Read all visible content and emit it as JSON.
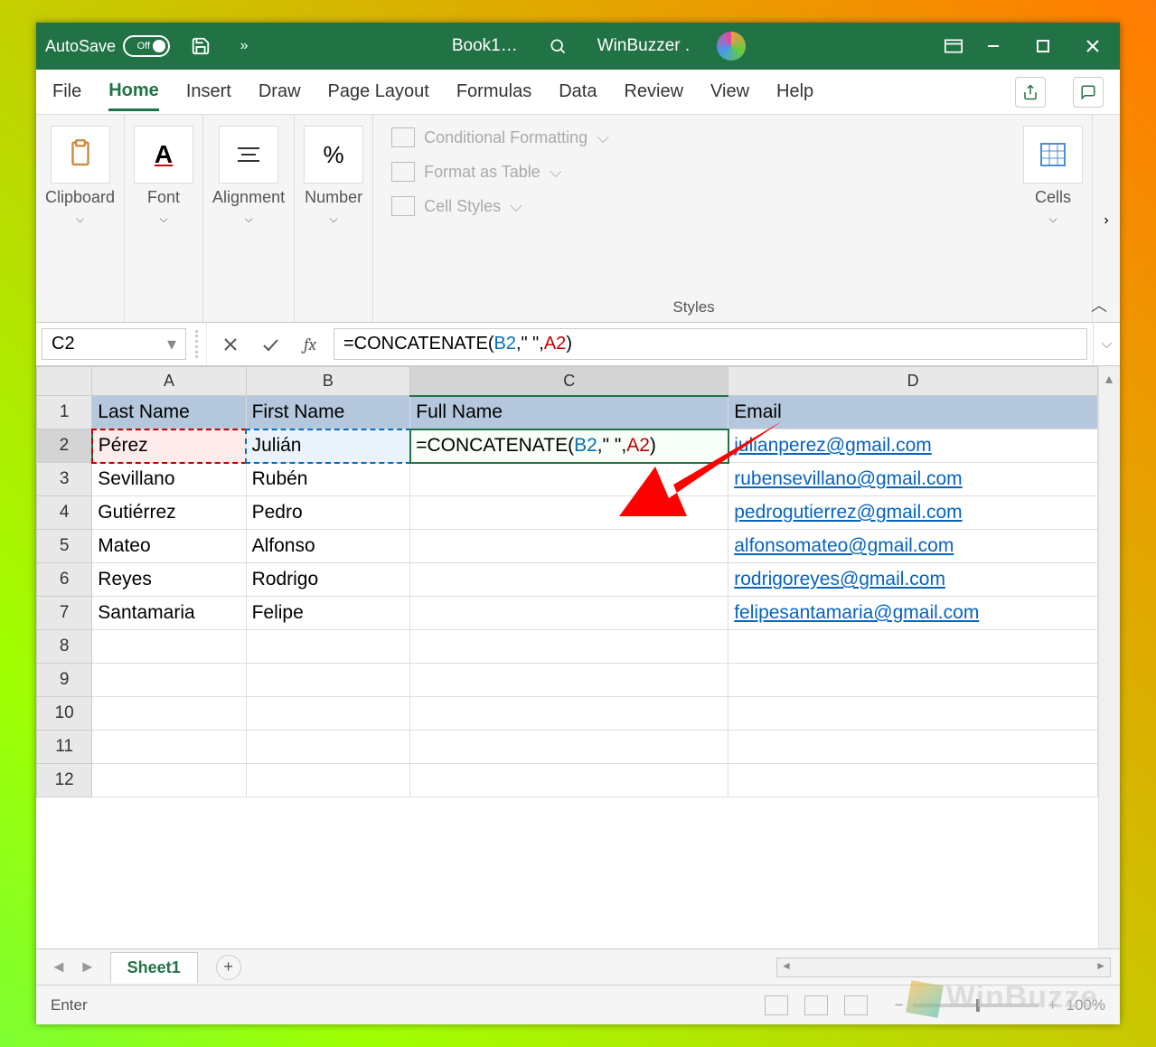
{
  "titlebar": {
    "autosave_label": "AutoSave",
    "autosave_state": "Off",
    "file_name": "Book1…",
    "user_name": "WinBuzzer ."
  },
  "tabs": {
    "file": "File",
    "home": "Home",
    "insert": "Insert",
    "draw": "Draw",
    "page_layout": "Page Layout",
    "formulas": "Formulas",
    "data": "Data",
    "review": "Review",
    "view": "View",
    "help": "Help",
    "active": "Home"
  },
  "ribbon": {
    "clipboard": "Clipboard",
    "font": "Font",
    "alignment": "Alignment",
    "number": "Number",
    "percent": "%",
    "styles_label": "Styles",
    "cond_fmt": "Conditional Formatting",
    "fmt_table": "Format as Table",
    "cell_styles": "Cell Styles",
    "cells": "Cells"
  },
  "formulabar": {
    "cell_ref": "C2",
    "fx": "fx",
    "formula_prefix": "=CONCATENATE(",
    "formula_ref1": "B2",
    "formula_mid": ",\" \",",
    "formula_ref2": "A2",
    "formula_suffix": ")"
  },
  "columns": [
    "A",
    "B",
    "C",
    "D"
  ],
  "headers": {
    "a": "Last Name",
    "b": "First Name",
    "c": "Full Name",
    "d": "Email"
  },
  "rows": [
    {
      "n": "1"
    },
    {
      "n": "2",
      "a": "Pérez",
      "b": "Julián",
      "c_edit": true,
      "d": "julianperez@gmail.com"
    },
    {
      "n": "3",
      "a": "Sevillano",
      "b": "Rubén",
      "d": "rubensevillano@gmail.com"
    },
    {
      "n": "4",
      "a": "Gutiérrez",
      "b": "Pedro",
      "d": "pedrogutierrez@gmail.com"
    },
    {
      "n": "5",
      "a": "Mateo",
      "b": "Alfonso",
      "d": "alfonsomateo@gmail.com"
    },
    {
      "n": "6",
      "a": "Reyes",
      "b": "Rodrigo",
      "d": "rodrigoreyes@gmail.com"
    },
    {
      "n": "7",
      "a": "Santamaria",
      "b": "Felipe",
      "d": "felipesantamaria@gmail.com"
    },
    {
      "n": "8"
    },
    {
      "n": "9"
    },
    {
      "n": "10"
    },
    {
      "n": "11"
    },
    {
      "n": "12"
    }
  ],
  "editing_formula": {
    "prefix": "=CONCATENATE(",
    "ref1": "B2",
    "mid": ",\" \",",
    "ref2": "A2",
    "suffix": ")"
  },
  "sheettabs": {
    "sheet1": "Sheet1"
  },
  "statusbar": {
    "mode": "Enter",
    "zoom": "100%"
  },
  "watermark": "WinBuzze"
}
